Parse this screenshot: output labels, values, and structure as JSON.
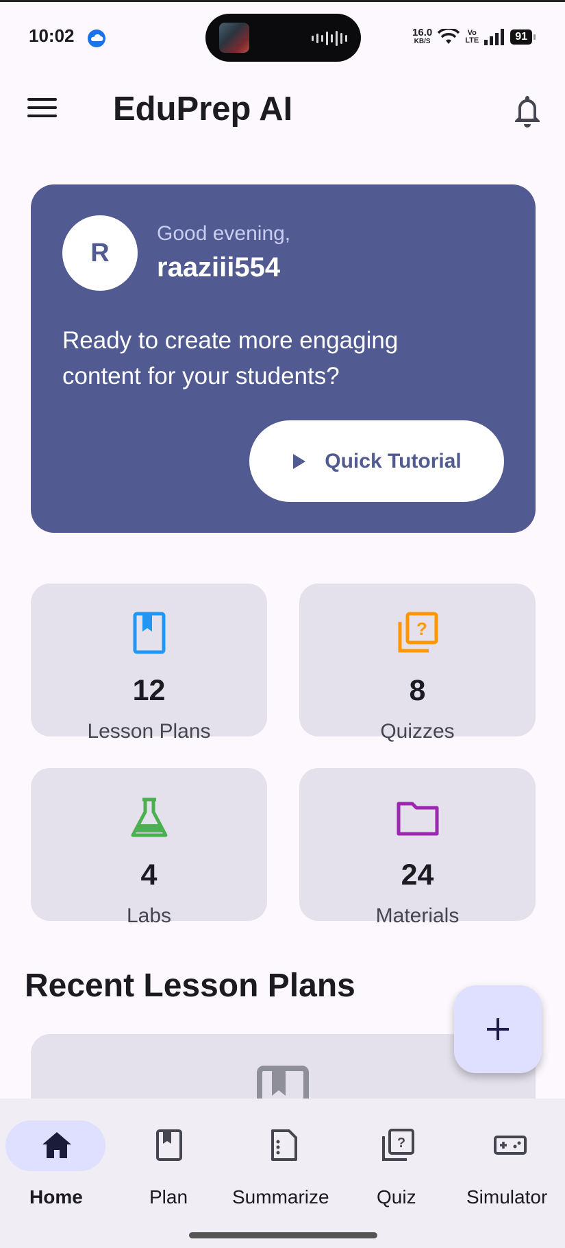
{
  "status_bar": {
    "time": "10:02",
    "net_speed": "16.0",
    "net_unit": "KB/S",
    "volte_top": "Vo",
    "volte_bottom": "LTE",
    "battery": "91"
  },
  "app_bar": {
    "title": "EduPrep AI",
    "menu_icon": "hamburger-menu-icon",
    "notification_icon": "bell-icon"
  },
  "welcome": {
    "avatar_initial": "R",
    "greeting": "Good evening,",
    "username": "raaziii554",
    "message": "Ready to create more engaging content for your students?",
    "tutorial_button": "Quick Tutorial",
    "card_color": "#515b92"
  },
  "stats": [
    {
      "value": "12",
      "label": "Lesson Plans",
      "icon": "book-icon",
      "color": "#2196f3"
    },
    {
      "value": "8",
      "label": "Quizzes",
      "icon": "quiz-icon",
      "color": "#ff9800"
    },
    {
      "value": "4",
      "label": "Labs",
      "icon": "flask-icon",
      "color": "#4caf50"
    },
    {
      "value": "24",
      "label": "Materials",
      "icon": "folder-icon",
      "color": "#9c27b0"
    }
  ],
  "recent": {
    "title": "Recent Lesson Plans"
  },
  "fab": {
    "icon": "plus-icon"
  },
  "nav": [
    {
      "label": "Home",
      "icon": "home-icon",
      "active": true
    },
    {
      "label": "Plan",
      "icon": "book-icon",
      "active": false
    },
    {
      "label": "Summarize",
      "icon": "summarize-icon",
      "active": false
    },
    {
      "label": "Quiz",
      "icon": "quiz-icon",
      "active": false
    },
    {
      "label": "Simulator",
      "icon": "gamepad-icon",
      "active": false
    }
  ]
}
